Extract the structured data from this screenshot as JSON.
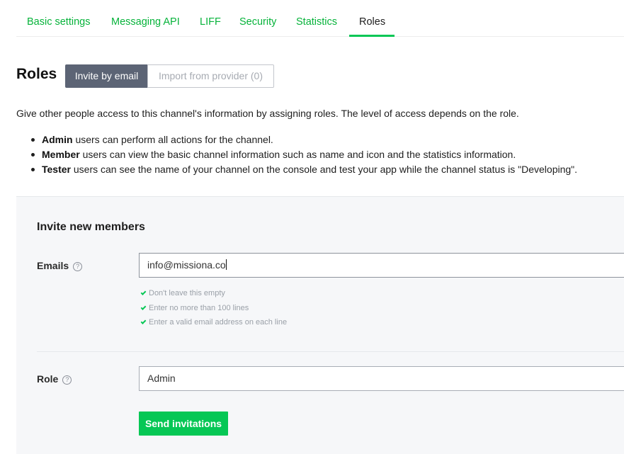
{
  "tabs": [
    {
      "label": "Basic settings",
      "active": false
    },
    {
      "label": "Messaging API",
      "active": false
    },
    {
      "label": "LIFF",
      "active": false
    },
    {
      "label": "Security",
      "active": false
    },
    {
      "label": "Statistics",
      "active": false
    },
    {
      "label": "Roles",
      "active": true
    }
  ],
  "page": {
    "title": "Roles",
    "segments": {
      "invite_by_email": "Invite by email",
      "import_from_provider": "Import from provider (0)"
    },
    "intro": "Give other people access to this channel's information by assigning roles. The level of access depends on the role.",
    "roles": [
      {
        "name": "Admin",
        "description": " users can perform all actions for the channel."
      },
      {
        "name": "Member",
        "description": " users can view the basic channel information such as name and icon and the statistics information."
      },
      {
        "name": "Tester",
        "description": " users can see the name of your channel on the console and test your app while the channel status is \"Developing\"."
      }
    ]
  },
  "invite": {
    "title": "Invite new members",
    "emails": {
      "label": "Emails",
      "value": "info@missiona.co",
      "validations": [
        "Don't leave this empty",
        "Enter no more than 100 lines",
        "Enter a valid email address on each line"
      ]
    },
    "role": {
      "label": "Role",
      "value": "Admin"
    },
    "send_label": "Send invitations"
  },
  "icons": {
    "help": "question-circle-icon",
    "check": "check-icon"
  },
  "colors": {
    "accent_green": "#06c755",
    "link_green": "#06b33a",
    "segment_active": "#5c6475"
  }
}
